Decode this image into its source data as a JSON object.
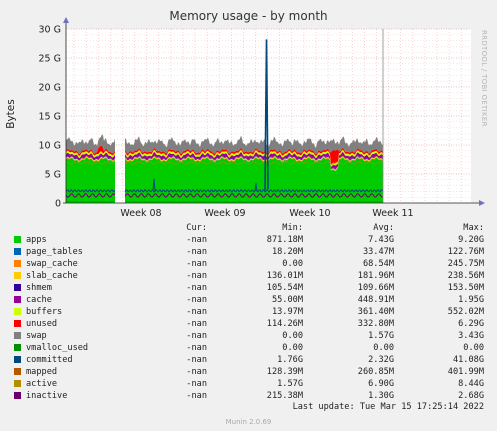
{
  "chart_data": {
    "type": "area",
    "title": "Memory usage - by month",
    "ylabel": "Bytes",
    "ylim": [
      0,
      30
    ],
    "yunit": "G",
    "yticks": [
      "0",
      "5 G",
      "10 G",
      "15 G",
      "20 G",
      "25 G",
      "30 G"
    ],
    "ytick_values": [
      0,
      5,
      10,
      15,
      20,
      25,
      30
    ],
    "x_tick_labels": [
      "Week 08",
      "Week 09",
      "Week 10",
      "Week 11"
    ],
    "grid": true,
    "series_colors": {
      "apps": "#00cc00",
      "page_tables": "#0066b3",
      "swap_cache": "#ff8000",
      "slab_cache": "#ffcc00",
      "shmem": "#330099",
      "cache": "#990099",
      "buffers": "#ccff00",
      "unused": "#ff0000",
      "swap": "#808080",
      "vmalloc_used": "#008f00",
      "committed": "#00487d",
      "mapped": "#b35a00",
      "active": "#b38f00",
      "inactive": "#6b006b"
    },
    "typical_values_G": {
      "apps": 7.43,
      "page_tables": 0.033,
      "swap_cache": 0.069,
      "slab_cache": 0.18,
      "shmem": 0.11,
      "cache": 0.45,
      "buffers": 0.36,
      "unused": 0.33,
      "swap": 1.57,
      "committed_spike_max": 28.2
    }
  },
  "watermark": "RRDTOOL / TOBI OETIKER",
  "legend": {
    "headers": [
      "Cur:",
      "Min:",
      "Avg:",
      "Max:"
    ],
    "rows": [
      {
        "name": "apps",
        "color": "#00cc00",
        "cur": "-nan",
        "min": "871.18M",
        "avg": "7.43G",
        "max": "9.20G"
      },
      {
        "name": "page_tables",
        "color": "#0066b3",
        "cur": "-nan",
        "min": "18.20M",
        "avg": "33.47M",
        "max": "122.76M"
      },
      {
        "name": "swap_cache",
        "color": "#ff8000",
        "cur": "-nan",
        "min": "0.00",
        "avg": "68.54M",
        "max": "245.75M"
      },
      {
        "name": "slab_cache",
        "color": "#ffcc00",
        "cur": "-nan",
        "min": "136.01M",
        "avg": "181.96M",
        "max": "238.56M"
      },
      {
        "name": "shmem",
        "color": "#330099",
        "cur": "-nan",
        "min": "105.54M",
        "avg": "109.66M",
        "max": "153.50M"
      },
      {
        "name": "cache",
        "color": "#990099",
        "cur": "-nan",
        "min": "55.00M",
        "avg": "448.91M",
        "max": "1.95G"
      },
      {
        "name": "buffers",
        "color": "#ccff00",
        "cur": "-nan",
        "min": "13.97M",
        "avg": "361.40M",
        "max": "552.02M"
      },
      {
        "name": "unused",
        "color": "#ff0000",
        "cur": "-nan",
        "min": "114.26M",
        "avg": "332.80M",
        "max": "6.29G"
      },
      {
        "name": "swap",
        "color": "#808080",
        "cur": "-nan",
        "min": "0.00",
        "avg": "1.57G",
        "max": "3.43G"
      },
      {
        "name": "vmalloc_used",
        "color": "#008f00",
        "cur": "-nan",
        "min": "0.00",
        "avg": "0.00",
        "max": "0.00"
      },
      {
        "name": "committed",
        "color": "#00487d",
        "cur": "-nan",
        "min": "1.76G",
        "avg": "2.32G",
        "max": "41.08G"
      },
      {
        "name": "mapped",
        "color": "#b35a00",
        "cur": "-nan",
        "min": "128.39M",
        "avg": "260.85M",
        "max": "401.99M"
      },
      {
        "name": "active",
        "color": "#b38f00",
        "cur": "-nan",
        "min": "1.57G",
        "avg": "6.90G",
        "max": "8.44G"
      },
      {
        "name": "inactive",
        "color": "#6b006b",
        "cur": "-nan",
        "min": "215.38M",
        "avg": "1.30G",
        "max": "2.68G"
      }
    ]
  },
  "last_update": "Last update: Tue Mar 15 17:25:14 2022",
  "footer": "Munin 2.0.69"
}
